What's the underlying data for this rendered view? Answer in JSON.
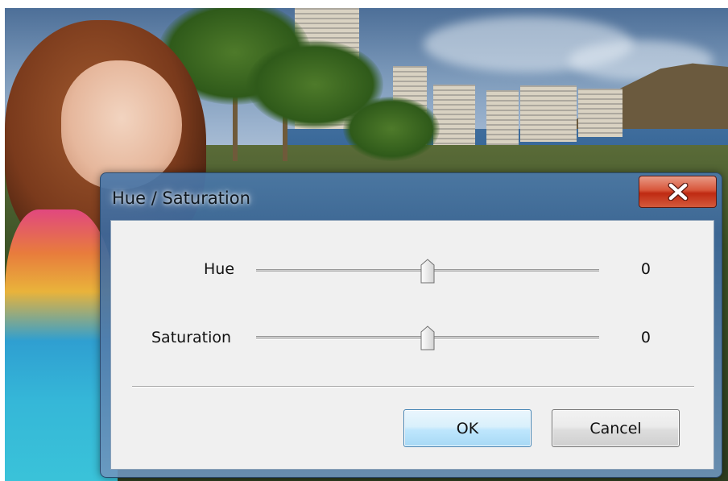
{
  "window": {
    "title": "Hue / Saturation",
    "close_icon": "close-icon"
  },
  "adjustments": [
    {
      "label": "Hue",
      "value": "0",
      "slider_fraction": 0.5
    },
    {
      "label": "Saturation",
      "value": "0",
      "slider_fraction": 0.5
    }
  ],
  "buttons": {
    "ok_label": "OK",
    "cancel_label": "Cancel"
  },
  "colors": {
    "close_button": "#c8371c",
    "ok_button_border": "#3c7fb1",
    "dialog_frame": "#3c689c",
    "client_background": "#f0f0f0"
  }
}
